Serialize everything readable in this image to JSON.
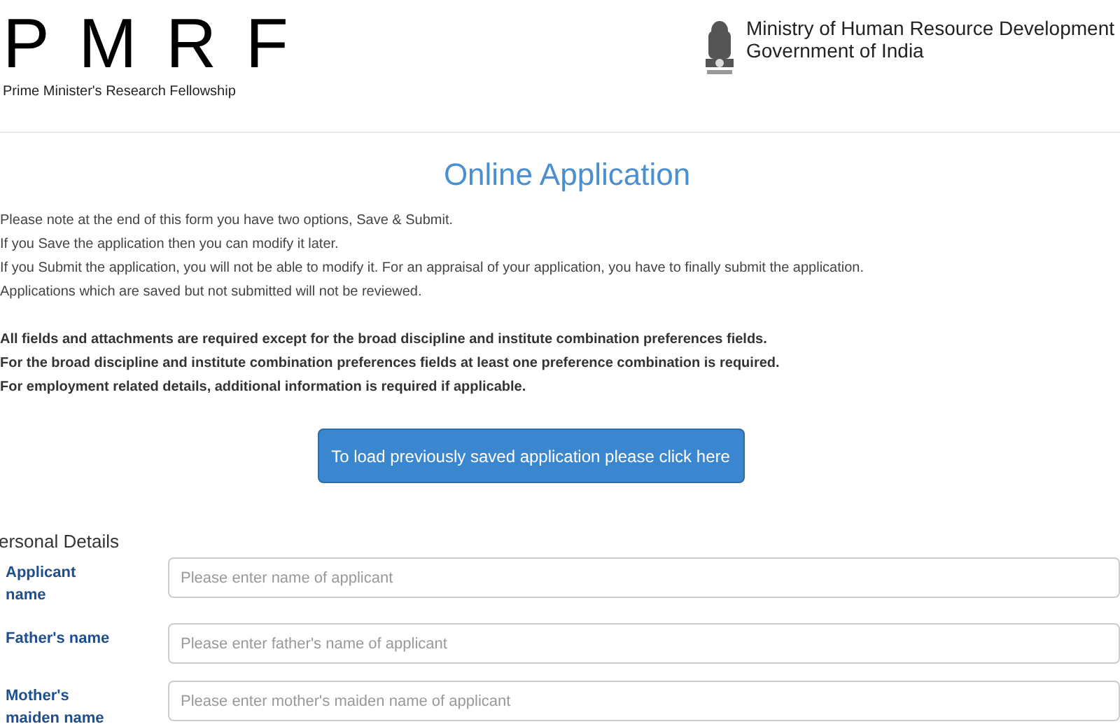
{
  "header": {
    "logo_letters": [
      "P",
      "M",
      "R",
      "F"
    ],
    "logo_subtitle": "Prime Minister's Research Fellowship",
    "ministry": "Ministry of Human Resource Development",
    "government": "Government of India"
  },
  "title": "Online Application",
  "notes": [
    "Please note at the end of this form you have two options, Save & Submit.",
    "If you Save the application then you can modify it later.",
    "If you Submit the application, you will not be able to modify it. For an appraisal of your application, you have to finally submit the application.",
    "Applications which are saved but not submitted will not be reviewed."
  ],
  "requirements": [
    "All fields and attachments are required except for the broad discipline and institute combination preferences fields.",
    "For the broad discipline and institute combination preferences fields at least one preference combination is required.",
    "For employment related details, additional information is required if applicable."
  ],
  "load_button": "To load previously saved application please click here",
  "section": "ersonal Details",
  "fields": [
    {
      "label": "Applicant name",
      "placeholder": "Please enter name of applicant"
    },
    {
      "label": "Father's name",
      "placeholder": "Please enter father's name of applicant"
    },
    {
      "label": "Mother's maiden name",
      "placeholder": "Please enter mother's maiden name of applicant"
    }
  ]
}
